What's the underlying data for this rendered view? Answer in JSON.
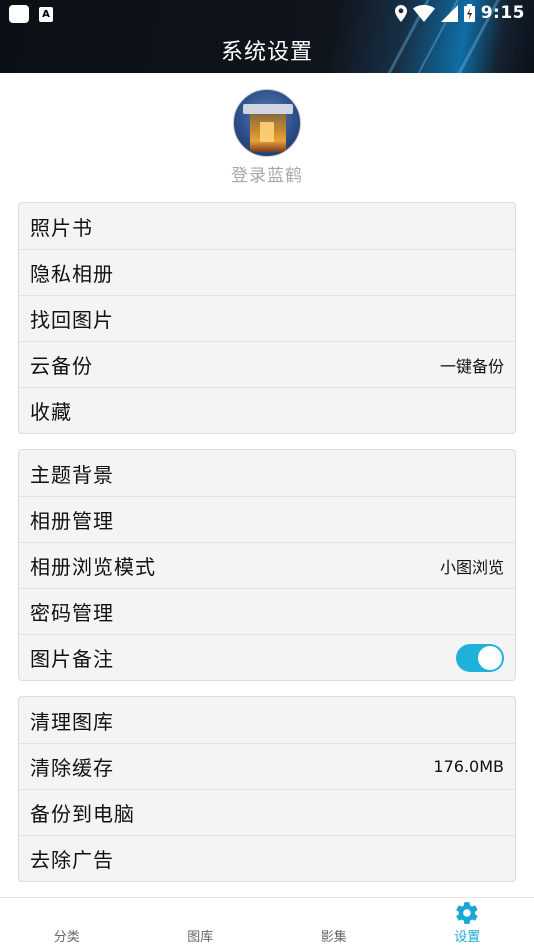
{
  "status_bar": {
    "time": "9:15",
    "icons": [
      "app-square-icon",
      "keyboard-a-icon",
      "location-pin-icon",
      "wifi-icon",
      "cell-signal-icon",
      "battery-charging-icon"
    ]
  },
  "header": {
    "title": "系统设置"
  },
  "profile": {
    "login_label": "登录蓝鹤"
  },
  "groups": [
    {
      "rows": [
        {
          "label": "照片书"
        },
        {
          "label": "隐私相册"
        },
        {
          "label": "找回图片"
        },
        {
          "label": "云备份",
          "value": "一键备份"
        },
        {
          "label": "收藏"
        }
      ]
    },
    {
      "rows": [
        {
          "label": "主题背景"
        },
        {
          "label": "相册管理"
        },
        {
          "label": "相册浏览模式",
          "value": "小图浏览"
        },
        {
          "label": "密码管理"
        },
        {
          "label": "图片备注",
          "toggle_on": true
        }
      ]
    },
    {
      "rows": [
        {
          "label": "清理图库"
        },
        {
          "label": "清除缓存",
          "value": "176.0MB"
        },
        {
          "label": "备份到电脑"
        },
        {
          "label": "去除广告"
        }
      ]
    }
  ],
  "bottom_nav": {
    "items": [
      {
        "label": "分类",
        "active": false
      },
      {
        "label": "图库",
        "active": false
      },
      {
        "label": "影集",
        "active": false
      },
      {
        "label": "设置",
        "active": true,
        "icon": "gear-icon"
      }
    ]
  },
  "colors": {
    "accent": "#1aa7d6",
    "toggle_on": "#1eb1d9",
    "header_bg": "#0b0f16"
  }
}
